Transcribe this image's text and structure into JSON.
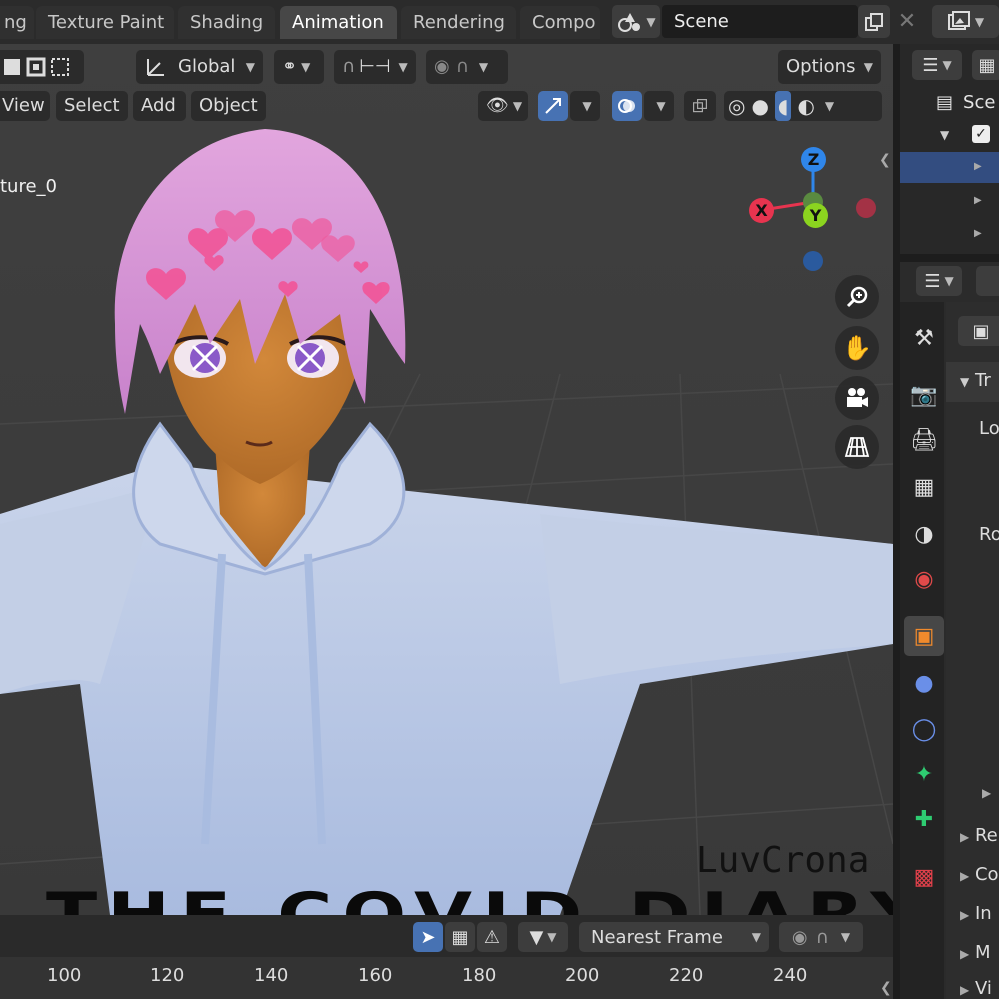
{
  "workspace_tabs": [
    "ng",
    "Texture Paint",
    "Shading",
    "Animation",
    "Rendering",
    "Compo"
  ],
  "active_tab": "Animation",
  "scene": {
    "name": "Scene"
  },
  "viewport_header": {
    "transform_orientation": "Global",
    "options_label": "Options",
    "menus": [
      "View",
      "Select",
      "Add",
      "Object"
    ]
  },
  "viewport_overlay_text": "ture_0",
  "gizmo": {
    "z": "Z",
    "x": "X",
    "y": "Y",
    "colors": {
      "x": "#e7344f",
      "y": "#8bd41f",
      "z": "#2f86ea"
    }
  },
  "watermark": {
    "author": "LuvCrona",
    "title": "THE COVID DIARY'S"
  },
  "timeline": {
    "snap_mode": "Nearest Frame",
    "frame_labels": [
      "100",
      "120",
      "140",
      "160",
      "180",
      "200",
      "220",
      "240"
    ]
  },
  "outliner": {
    "scene_label": "Sce"
  },
  "properties": {
    "section_transform": "Tr",
    "location_label": "Lo",
    "rotation_label": "Ro",
    "collapsed_sections": [
      "Re",
      "Co",
      "In",
      "M",
      "Vi"
    ]
  },
  "colors": {
    "accent": "#4772b3",
    "viewport_bg": "#3d3d3d"
  }
}
